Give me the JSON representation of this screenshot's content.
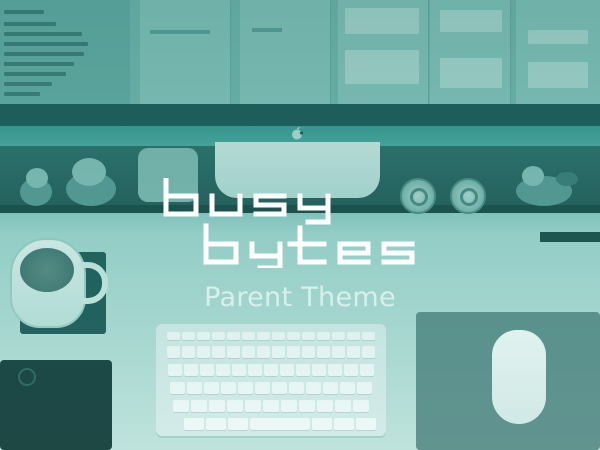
{
  "logo": {
    "lines": [
      "busy",
      "bytes"
    ],
    "color": "#ffffff"
  },
  "subtitle": "Parent Theme",
  "colors": {
    "accent": "#2a8f88",
    "subtitle": "#d8f0ec"
  }
}
